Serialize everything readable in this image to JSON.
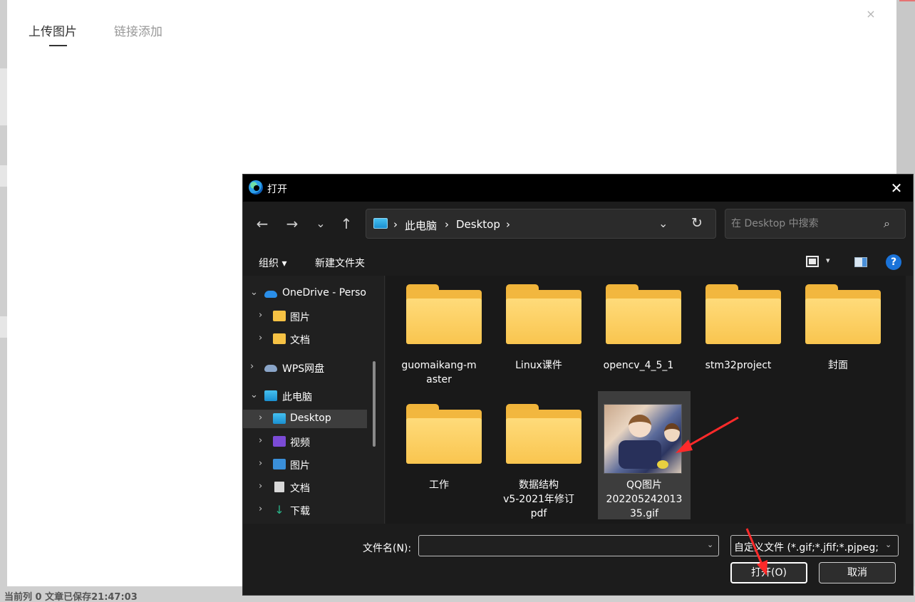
{
  "background": {
    "status_text": "当前列 0   文章已保存21:47:03"
  },
  "upload_modal": {
    "tabs": [
      {
        "label": "上传图片",
        "active": true
      },
      {
        "label": "链接添加",
        "active": false
      }
    ],
    "close_glyph": "×"
  },
  "dialog": {
    "title": "打开",
    "close_glyph": "✕",
    "nav": {
      "back_glyph": "←",
      "forward_glyph": "→",
      "recent_glyph": "⌄",
      "up_glyph": "↑"
    },
    "address": {
      "crumbs": [
        "此电脑",
        "Desktop"
      ],
      "separator": "›",
      "dropdown_glyph": "⌄",
      "refresh_glyph": "↻"
    },
    "search": {
      "placeholder": "在 Desktop 中搜索",
      "value": ""
    },
    "toolbar": {
      "organize_label": "组织 ▾",
      "new_folder_label": "新建文件夹",
      "view_caret": "▾",
      "help_glyph": "?"
    },
    "sidebar": [
      {
        "label": "OneDrive - Perso",
        "icon": "onedrive-cloud-icon",
        "expanded": true
      },
      {
        "label": "图片",
        "icon": "folder-icon",
        "expanded": false
      },
      {
        "label": "文档",
        "icon": "folder-icon",
        "expanded": false
      },
      {
        "label": "WPS网盘",
        "icon": "wps-cloud-icon",
        "expanded": false
      },
      {
        "label": "此电脑",
        "icon": "this-pc-icon",
        "expanded": true
      },
      {
        "label": "Desktop",
        "icon": "desktop-icon",
        "expanded": false,
        "selected": true
      },
      {
        "label": "视频",
        "icon": "videos-icon",
        "expanded": false
      },
      {
        "label": "图片",
        "icon": "pictures-icon",
        "expanded": false
      },
      {
        "label": "文档",
        "icon": "documents-icon",
        "expanded": false
      },
      {
        "label": "下载",
        "icon": "downloads-icon",
        "expanded": false
      }
    ],
    "files": [
      {
        "name": "guomaikang-m\naster",
        "type": "folder"
      },
      {
        "name": "Linux课件",
        "type": "folder"
      },
      {
        "name": "opencv_4_5_1",
        "type": "folder"
      },
      {
        "name": "stm32project",
        "type": "folder"
      },
      {
        "name": "封面",
        "type": "folder"
      },
      {
        "name": "工作",
        "type": "folder"
      },
      {
        "name": "数据结构\nv5-2021年修订\npdf",
        "type": "folder"
      },
      {
        "name": "QQ图片\n202205242013\n35.gif",
        "type": "image",
        "selected": true
      }
    ],
    "footer": {
      "filename_label": "文件名(N):",
      "filename_value": "",
      "filetype_value": "自定义文件 (*.gif;*.jfif;*.pjpeg;",
      "open_label": "打开(O)",
      "cancel_label": "取消"
    }
  },
  "colors": {
    "annotation_arrow": "#ff2a2a",
    "dialog_bg": "#202020",
    "folder_yellow": "#f9c54f",
    "help_blue": "#1a73d9"
  }
}
